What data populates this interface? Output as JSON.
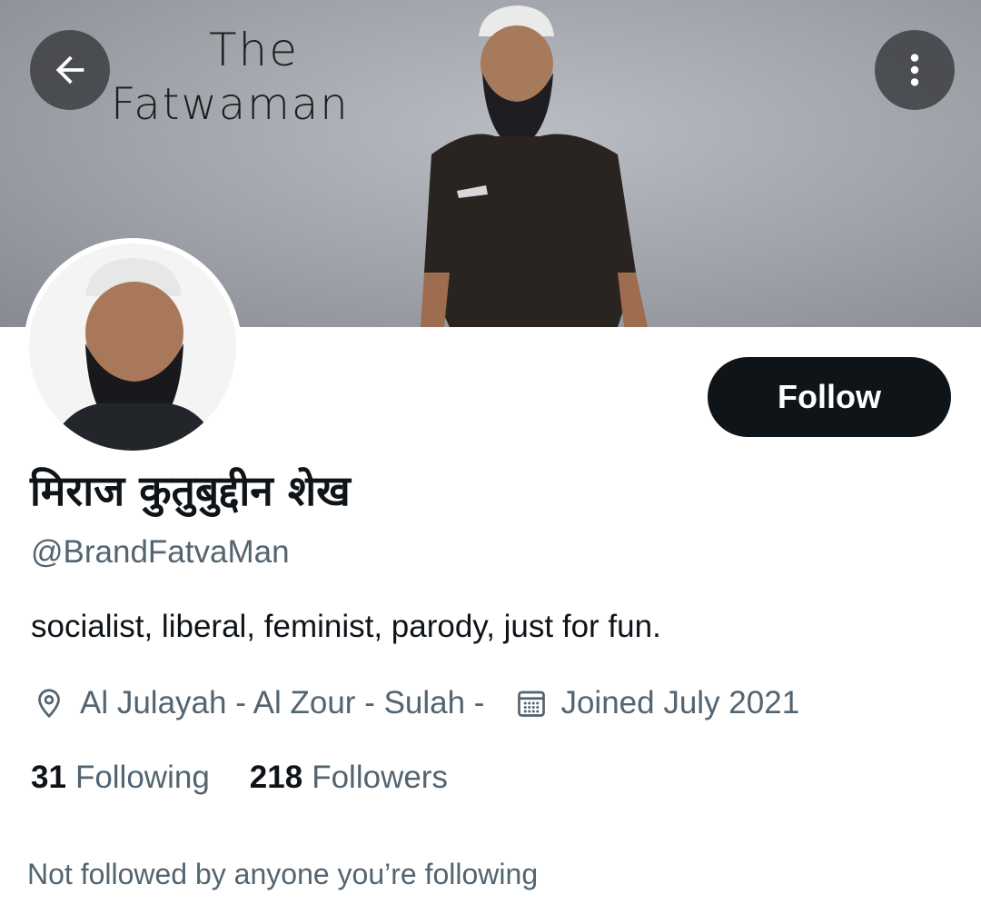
{
  "banner": {
    "title_line1": "The",
    "title_line2": "Fatwaman"
  },
  "header": {
    "back_icon": "arrow-left-icon",
    "more_icon": "more-vertical-icon"
  },
  "profile": {
    "display_name": "मिराज कुतुबुद्दीन शेख",
    "handle": "@BrandFatvaMan",
    "bio": "socialist, liberal, feminist, parody, just for fun.",
    "location": "Al Julayah - Al Zour - Sulah -",
    "joined": "Joined July 2021",
    "following_count": "31",
    "following_label": "Following",
    "followers_count": "218",
    "followers_label": "Followers",
    "not_followed_text": "Not followed by anyone you’re following"
  },
  "actions": {
    "follow_label": "Follow"
  },
  "colors": {
    "primary_text": "#0f1419",
    "secondary_text": "#536471",
    "follow_button_bg": "#0f1419"
  }
}
